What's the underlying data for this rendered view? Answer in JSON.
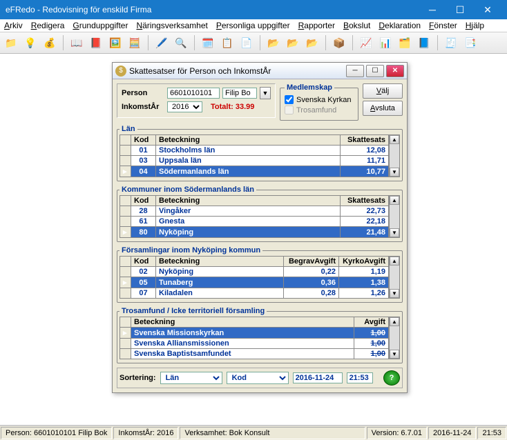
{
  "window": {
    "title": "eFRedo - Redovisning för enskild Firma"
  },
  "menu": [
    "Arkiv",
    "Redigera",
    "Grunduppgifter",
    "Näringsverksamhet",
    "Personliga uppgifter",
    "Rapporter",
    "Bokslut",
    "Deklaration",
    "Fönster",
    "Hjälp"
  ],
  "dialog": {
    "title": "Skattesatser för Person och InkomstÅr",
    "person_label": "Person",
    "person_id": "6601010101",
    "person_name": "Filip Bo",
    "year_label": "InkomstÅr",
    "year": "2016",
    "totalt_label": "Totalt:",
    "totalt_value": "33.99",
    "medlem_legend": "Medlemskap",
    "chk_svk": "Svenska Kyrkan",
    "chk_tros": "Trosamfund",
    "btn_valj": "Välj",
    "btn_avsluta": "Avsluta"
  },
  "lan": {
    "legend": "Län",
    "cols": [
      "Kod",
      "Beteckning",
      "Skattesats"
    ],
    "rows": [
      {
        "kod": "01",
        "bet": "Stockholms län",
        "sk": "12,08"
      },
      {
        "kod": "03",
        "bet": "Uppsala län",
        "sk": "11,71"
      },
      {
        "kod": "04",
        "bet": "Södermanlands län",
        "sk": "10,77",
        "sel": true
      }
    ]
  },
  "kommun": {
    "legend": "Kommuner inom Södermanlands län",
    "cols": [
      "Kod",
      "Beteckning",
      "Skattesats"
    ],
    "rows": [
      {
        "kod": "28",
        "bet": "Vingåker",
        "sk": "22,73"
      },
      {
        "kod": "61",
        "bet": "Gnesta",
        "sk": "22,18"
      },
      {
        "kod": "80",
        "bet": "Nyköping",
        "sk": "21,48",
        "sel": true
      }
    ]
  },
  "fors": {
    "legend": "Församlingar inom Nyköping kommun",
    "cols": [
      "Kod",
      "Beteckning",
      "BegravAvgift",
      "KyrkoAvgift"
    ],
    "rows": [
      {
        "kod": "02",
        "bet": "Nyköping",
        "b": "0,22",
        "k": "1,19"
      },
      {
        "kod": "05",
        "bet": "Tunaberg",
        "b": "0,36",
        "k": "1,38",
        "sel": true
      },
      {
        "kod": "07",
        "bet": "Kiladalen",
        "b": "0,28",
        "k": "1,26"
      }
    ]
  },
  "tros": {
    "legend": "Trosamfund / Icke territoriell församling",
    "cols": [
      "Beteckning",
      "Avgift"
    ],
    "rows": [
      {
        "bet": "Svenska Missionskyrkan",
        "a": "1,00",
        "sel": true
      },
      {
        "bet": "Svenska Alliansmissionen",
        "a": "1,00"
      },
      {
        "bet": "Svenska Baptistsamfundet",
        "a": "1,00"
      }
    ]
  },
  "sort": {
    "label": "Sortering:",
    "s1": "Län",
    "s2": "Kod",
    "date": "2016-11-24",
    "time": "21:53"
  },
  "status": {
    "person": "Person: 6601010101  Filip Bok",
    "year": "InkomstÅr: 2016",
    "verk": "Verksamhet: Bok Konsult",
    "ver": "Version: 6.7.01",
    "date": "2016-11-24",
    "time": "21:53"
  }
}
